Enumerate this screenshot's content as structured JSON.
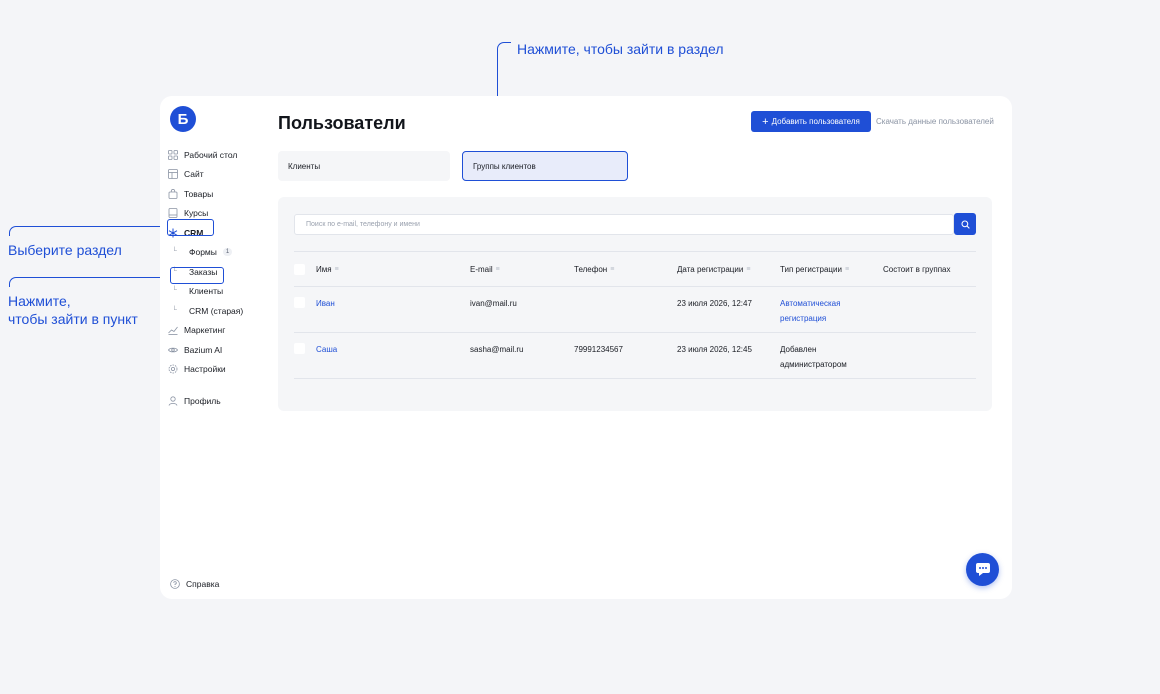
{
  "annotations": {
    "top": "Нажмите, чтобы зайти в раздел",
    "select_section": "Выберите раздел",
    "enter_item_line1": "Нажмите,",
    "enter_item_line2": "чтобы зайти в пункт"
  },
  "logo": {
    "letter": "Б"
  },
  "sidebar": {
    "items": [
      {
        "label": "Рабочий стол",
        "icon": "grid-icon"
      },
      {
        "label": "Сайт",
        "icon": "layout-icon"
      },
      {
        "label": "Товары",
        "icon": "bag-icon"
      },
      {
        "label": "Курсы",
        "icon": "book-icon"
      },
      {
        "label": "CRM",
        "icon": "snowflake-icon"
      },
      {
        "label": "Формы",
        "badge": "1"
      },
      {
        "label": "Заказы"
      },
      {
        "label": "Клиенты"
      },
      {
        "label": "CRM (старая)"
      },
      {
        "label": "Маркетинг",
        "icon": "chart-icon"
      },
      {
        "label": "Bazium AI",
        "icon": "eye-icon"
      },
      {
        "label": "Настройки",
        "icon": "gear-icon"
      },
      {
        "label": "Профиль",
        "icon": "user-icon"
      }
    ],
    "help": "Справка"
  },
  "header": {
    "title": "Пользователи",
    "add_button": "Добавить пользователя",
    "download_link": "Скачать данные пользователей"
  },
  "tabs": {
    "clients": "Клиенты",
    "groups": "Группы клиентов"
  },
  "search": {
    "placeholder": "Поиск по e-mail, телефону и имени"
  },
  "table": {
    "columns": [
      "Имя",
      "E-mail",
      "Телефон",
      "Дата регистрации",
      "Тип регистрации",
      "Состоит в группах"
    ],
    "rows": [
      {
        "name": "Иван",
        "email": "ivan@mail.ru",
        "phone": "",
        "date": "23 июля 2026, 12:47",
        "type_line1": "Автоматическая",
        "type_line2": "регистрация",
        "groups": ""
      },
      {
        "name": "Саша",
        "email": "sasha@mail.ru",
        "phone": "79991234567",
        "date": "23 июля 2026, 12:45",
        "type_line1": "Добавлен",
        "type_line2": "администратором",
        "groups": ""
      }
    ]
  },
  "colors": {
    "accent": "#1f4fd6",
    "annotation": "#1f4fd6"
  }
}
